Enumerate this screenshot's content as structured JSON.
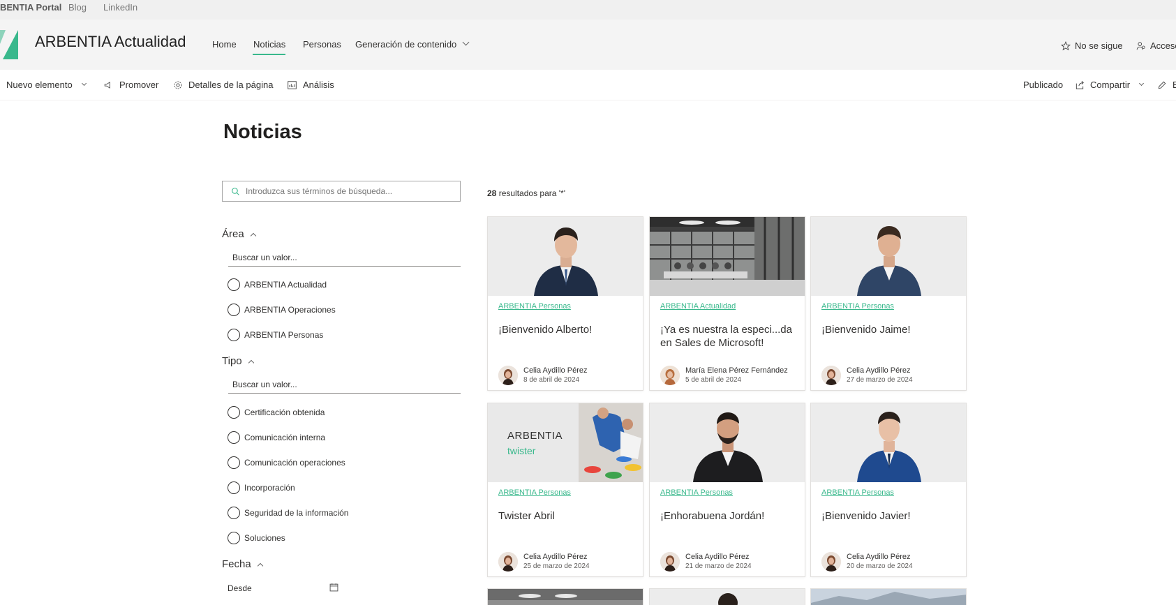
{
  "portal": {
    "brand": "BENTIA Portal",
    "links": [
      "Blog",
      "LinkedIn"
    ]
  },
  "header": {
    "title": "ARBENTIA Actualidad",
    "nav": [
      "Home",
      "Noticias",
      "Personas",
      "Generación de contenido"
    ],
    "follow": "No se sigue",
    "access": "Acceso"
  },
  "command_bar": {
    "new_item": "Nuevo elemento",
    "promote": "Promover",
    "page_details": "Detalles de la página",
    "analytics": "Análisis",
    "published": "Publicado",
    "share": "Compartir",
    "edit": "E"
  },
  "page_title": "Noticias",
  "search": {
    "placeholder": "Introduzca sus términos de búsqueda..."
  },
  "facets": {
    "area": {
      "label": "Área",
      "search_placeholder": "Buscar un valor...",
      "options": [
        "ARBENTIA Actualidad",
        "ARBENTIA Operaciones",
        "ARBENTIA Personas"
      ]
    },
    "tipo": {
      "label": "Tipo",
      "search_placeholder": "Buscar un valor...",
      "options": [
        "Certificación obtenida",
        "Comunicación interna",
        "Comunicación operaciones",
        "Incorporación",
        "Seguridad de la información",
        "Soluciones"
      ]
    },
    "fecha": {
      "label": "Fecha",
      "from": "Desde"
    }
  },
  "results": {
    "count": "28",
    "suffix": "resultados para '*'"
  },
  "cards": [
    {
      "category": "ARBENTIA Personas",
      "title": "¡Bienvenido Alberto!",
      "author": "Celia Aydillo Pérez",
      "date": "8 de abril de 2024"
    },
    {
      "category": "ARBENTIA Actualidad",
      "title": "¡Ya es nuestra la especi...da en Sales de Microsoft!",
      "author": "María Elena Pérez Fernández",
      "date": "5 de abril de 2024"
    },
    {
      "category": "ARBENTIA Personas",
      "title": "¡Bienvenido Jaime!",
      "author": "Celia Aydillo Pérez",
      "date": "27 de marzo de 2024"
    },
    {
      "category": "ARBENTIA Personas",
      "title": "Twister Abril",
      "author": "Celia Aydillo Pérez",
      "date": "25 de marzo de 2024",
      "thumb_text": "ARBENTIA",
      "thumb_sub": "twister"
    },
    {
      "category": "ARBENTIA Personas",
      "title": "¡Enhorabuena Jordán!",
      "author": "Celia Aydillo Pérez",
      "date": "21 de marzo de 2024"
    },
    {
      "category": "ARBENTIA Personas",
      "title": "¡Bienvenido Javier!",
      "author": "Celia Aydillo Pérez",
      "date": "20 de marzo de 2024"
    }
  ],
  "colors": {
    "accent": "#39b88c",
    "header_bg": "#f4f4f4",
    "portal_bg": "#f0f0f0"
  }
}
